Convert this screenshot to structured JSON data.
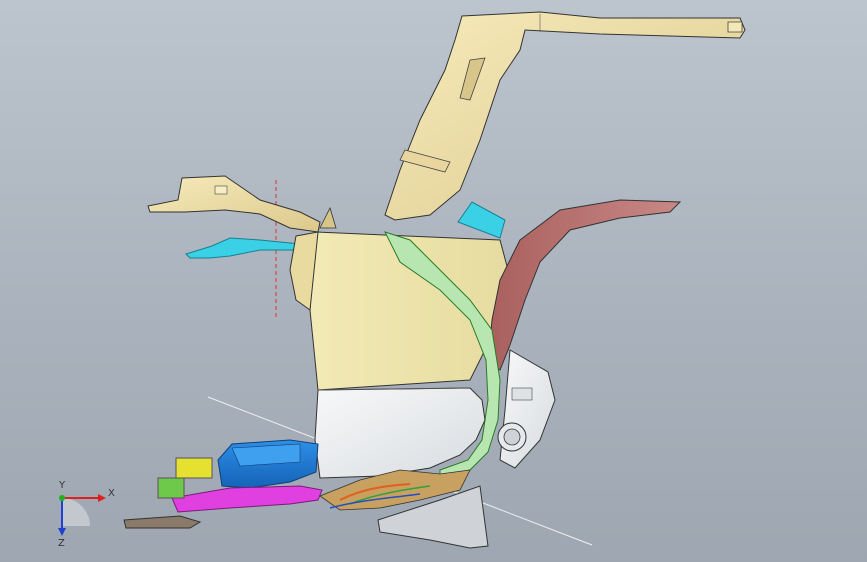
{
  "viewport": {
    "background_top": "#bcc4cd",
    "background_bottom": "#9ea7b1"
  },
  "triad": {
    "x_label": "X",
    "y_label": "Y",
    "z_label": "Z",
    "x_color": "#e02020",
    "y_color": "#20b020",
    "z_color": "#2040d0"
  },
  "model": {
    "colors": {
      "beige": "#efe0a8",
      "beige_dark": "#cdb87a",
      "maroon": "#b06a68",
      "cyan": "#3ad0e6",
      "blue": "#1f7bd6",
      "magenta": "#e040e0",
      "yellow": "#e6e030",
      "green": "#6ec84a",
      "white_grey": "#eef0f2",
      "grey": "#cfd3d8"
    }
  }
}
